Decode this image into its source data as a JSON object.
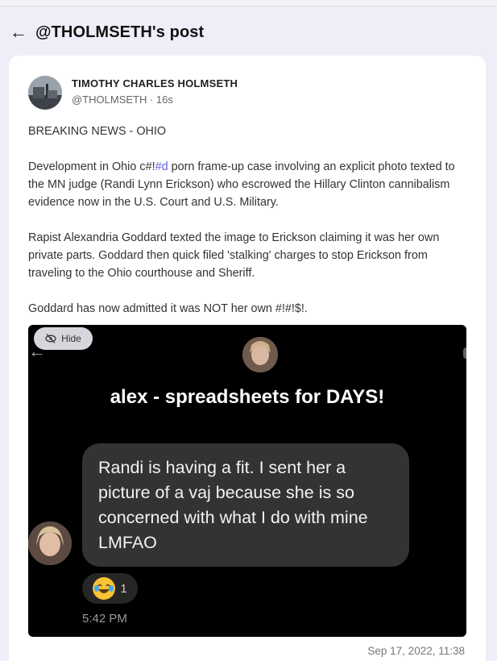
{
  "header": {
    "back_icon": "arrow-left-icon",
    "title": "@THOLMSETH's post"
  },
  "post": {
    "author_name": "TIMOTHY CHARLES HOLMSETH",
    "author_handle_time": "@THOLMSETH · 16s",
    "paragraphs": {
      "p1": "BREAKING NEWS - OHIO",
      "p2_before_tag": "Development in Ohio c#!",
      "p2_tag": "#d",
      "p2_after_tag": " porn frame-up case involving an explicit photo texted to the MN judge (Randi Lynn Erickson) who escrowed the Hillary Clinton cannibalism evidence now in the U.S. Court and U.S. Military.",
      "p3": "Rapist Alexandria Goddard texted the image to Erickson claiming it was her own private parts. Goddard then quick filed 'stalking' charges to stop Erickson from traveling to the Ohio courthouse and Sheriff.",
      "p4": "Goddard has now admitted it was NOT her own #!#!$!."
    },
    "hide_label": "Hide",
    "hide_icon": "eye-slash-icon",
    "date": "Sep 17, 2022, 11:38"
  },
  "media": {
    "chat_title": "alex - spreadsheets for DAYS!",
    "message": "Randi is having a fit. I sent her a picture of a vaj because she is so concerned with what I do with mine LMFAO",
    "reaction_icon": "laughing-tears-emoji-icon",
    "reaction_count": "1",
    "time": "5:42 PM"
  },
  "colors": {
    "page_bg": "#eeeef8",
    "tag_link": "#5b5fe0",
    "bubble_bg": "#333333"
  }
}
